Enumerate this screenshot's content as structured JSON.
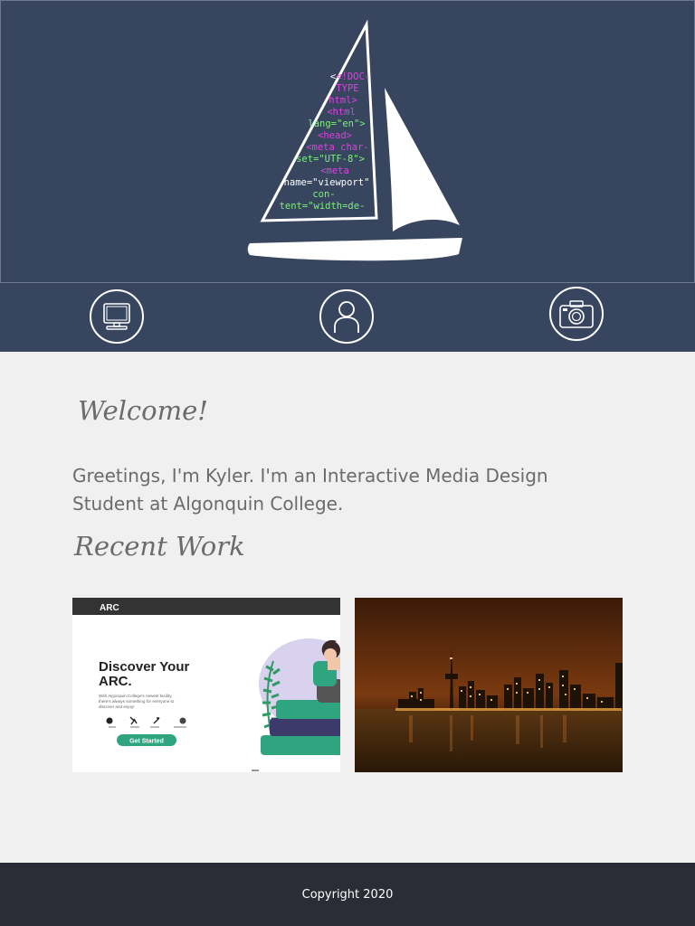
{
  "hero": {
    "logo_name": "sailboat-code-logo",
    "code_lines": [
      "<!DOC-",
      "TYPE",
      "html>",
      "<html",
      "lang=\"en\">",
      "<head>",
      "<meta char-",
      "set=\"UTF-8\">",
      "<meta",
      "name=\"viewport\"",
      "con-",
      "tent=\"width=de-"
    ],
    "colors": {
      "background": "#37455f",
      "tag": "#e040e0",
      "attr": "#7cf07c",
      "string": "#ffffff"
    }
  },
  "nav": {
    "items": [
      {
        "icon": "computer-icon"
      },
      {
        "icon": "user-icon"
      },
      {
        "icon": "camera-icon"
      }
    ]
  },
  "main": {
    "welcome_title": "Welcome!",
    "intro_text": "Greetings, I'm Kyler. I'm an Interactive Media Design Student at Algonquin College.",
    "recent_title": "Recent Work"
  },
  "work": {
    "arc": {
      "brand": "ARC",
      "headline_line1": "Discover Your",
      "headline_line2": "ARC.",
      "description_line1": "With Algonquin College's newest facility,",
      "description_line2": "there's always something for everyone to",
      "description_line3": "discover and enjoy!",
      "cta": "Get Started",
      "accent": "#2fa57f"
    },
    "skyline": {
      "icon": "city-skyline-night-image"
    }
  },
  "footer": {
    "copyright": "Copyright 2020"
  }
}
